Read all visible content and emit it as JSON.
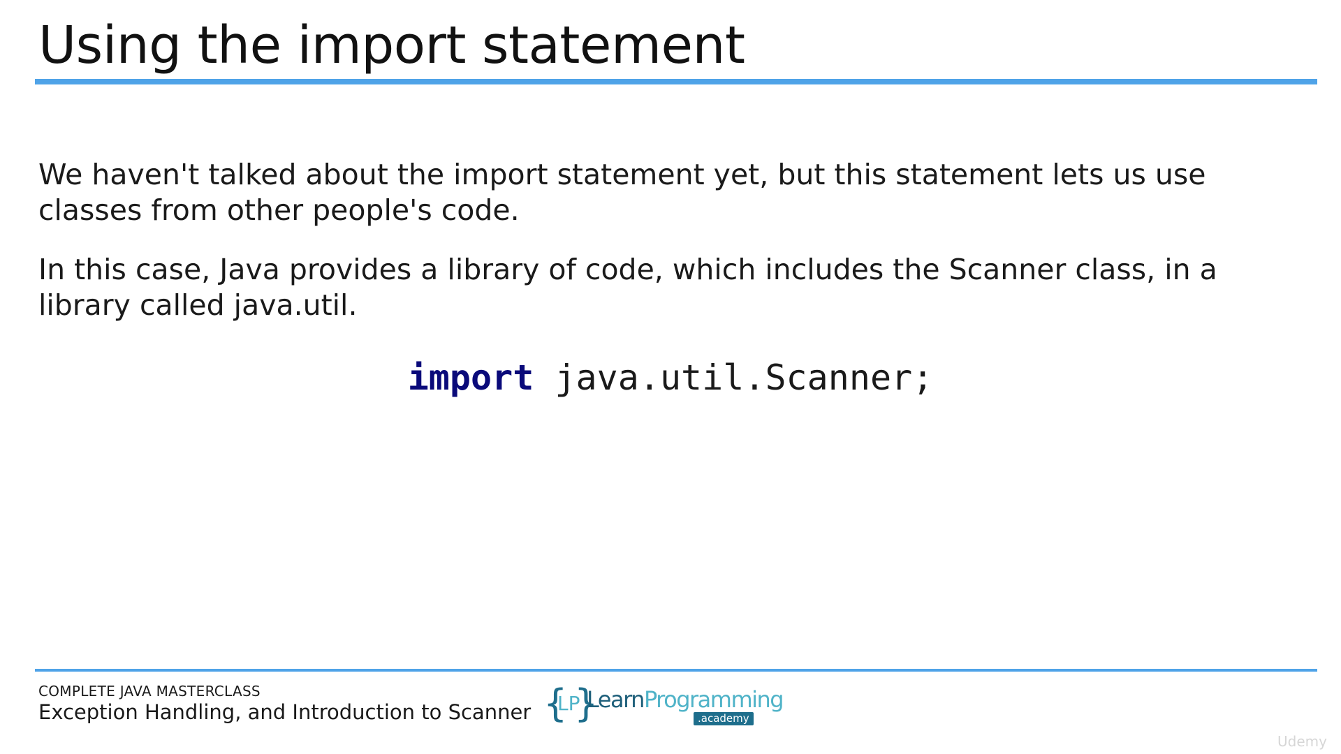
{
  "slide": {
    "title": "Using the import statement",
    "paragraphs": [
      "We haven't talked about the import statement yet, but this statement lets us use classes from other people's code.",
      "In this case, Java provides a library of code, which includes the Scanner class, in a library called java.util."
    ],
    "code": {
      "keyword": "import",
      "rest": " java.util.Scanner;"
    }
  },
  "footer": {
    "course": "COMPLETE JAVA MASTERCLASS",
    "section": "Exception Handling, and Introduction to Scanner",
    "logo": {
      "brace_open": "{",
      "initials": "LP",
      "brace_close": "}",
      "learn": "Learn",
      "programming": "Programming",
      "academy": ".academy"
    },
    "watermark": "Udemy"
  },
  "colors": {
    "accent_rule": "#4fa3e8",
    "keyword": "#0a0a7a",
    "logo_dark": "#1e6e8c",
    "logo_light": "#4fb3c8"
  }
}
